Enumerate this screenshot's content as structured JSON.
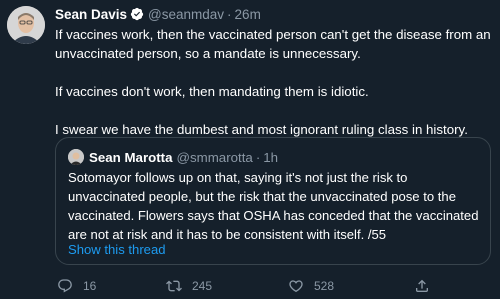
{
  "tweet": {
    "author_name": "Sean Davis",
    "author_handle": "@seanmdav",
    "separator": "·",
    "time": "26m",
    "paragraphs": [
      "If vaccines work, then the vaccinated person can't get the disease from an unvaccinated person, so a mandate is unnecessary.",
      "If vaccines don't work, then mandating them is idiotic.",
      "I swear we have the dumbest and most ignorant ruling class in history."
    ]
  },
  "quoted_tweet": {
    "author_name": "Sean Marotta",
    "author_handle": "@smmarotta",
    "separator": "·",
    "time": "1h",
    "text": "Sotomayor follows up on that, saying it's not just the risk to unvaccinated people, but the risk that the unvaccinated pose to the vaccinated.  Flowers says that OSHA has conceded that the vaccinated are not at risk and it has to be consistent with itself. /55",
    "show_thread_label": "Show this thread"
  },
  "actions": {
    "reply_count": "16",
    "retweet_count": "245",
    "like_count": "528"
  },
  "icons": {
    "verified": "verified-badge-icon",
    "reply": "reply-icon",
    "retweet": "retweet-icon",
    "like": "heart-icon",
    "share": "share-icon"
  },
  "colors": {
    "background": "#15202b",
    "text_primary": "#ffffff",
    "text_secondary": "#8b98a5",
    "accent": "#1d9bf0",
    "border": "#38444d"
  }
}
